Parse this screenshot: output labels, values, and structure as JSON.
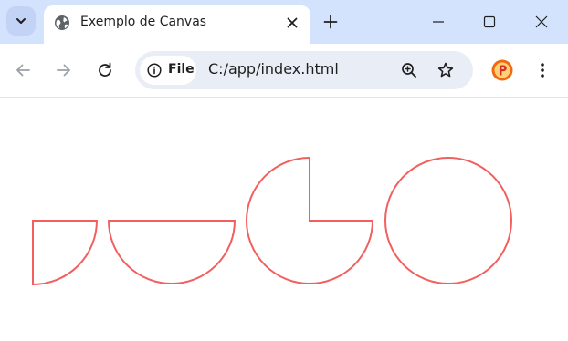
{
  "tab": {
    "title": "Exemplo de Canvas"
  },
  "address_bar": {
    "chip_label": "File",
    "url": "C:/app/index.html"
  },
  "colors": {
    "tabbar_bg": "#d3e3fd",
    "shape_stroke": "#f25f5f",
    "profile_accent": "#f06a10"
  },
  "icons": [
    "tab-search-icon",
    "globe-icon",
    "close-icon",
    "plus-icon",
    "minimize-icon",
    "maximize-icon",
    "window-close-icon",
    "back-arrow-icon",
    "forward-arrow-icon",
    "reload-icon",
    "info-icon",
    "zoom-icon",
    "star-icon",
    "profile-icon",
    "kebab-menu-icon"
  ]
}
